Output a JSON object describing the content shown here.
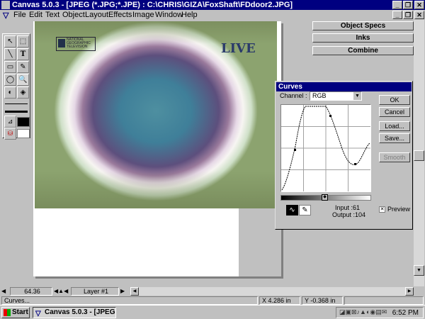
{
  "window": {
    "title": "Canvas 5.0.3 - [JPEG (*.JPG;*.JPE) : C:\\CHRIS\\GIZA\\FoxShaft\\FDdoor2.JPG]",
    "minimize": "_",
    "restore": "❐",
    "close": "✕"
  },
  "menu": {
    "items": [
      "File",
      "Edit",
      "Text",
      "Object",
      "Layout",
      "Effects",
      "Image",
      "Window",
      "Help"
    ]
  },
  "palettes": {
    "object_specs": "Object Specs",
    "inks": "Inks",
    "combine": "Combine"
  },
  "image": {
    "overlay_live": "LIVE"
  },
  "curves": {
    "title": "Curves",
    "channel_label": "Channel :",
    "channel_value": "RGB",
    "ok": "OK",
    "cancel": "Cancel",
    "load": "Load...",
    "save": "Save...",
    "smooth": "Smooth",
    "input_label": "Input :",
    "input_value": "61",
    "output_label": "Output :",
    "output_value": "104",
    "preview_label": "Preview",
    "preview_checked": true
  },
  "status": {
    "zoom": "64.36",
    "layer": "Layer #1",
    "tool_name": "Curves...",
    "x_coord": "X 4.286 in",
    "y_coord": "Y -0.368 in"
  },
  "taskbar": {
    "start": "Start",
    "task": "Canvas 5.0.3 - [JPEG...",
    "clock": "6:52 PM"
  }
}
